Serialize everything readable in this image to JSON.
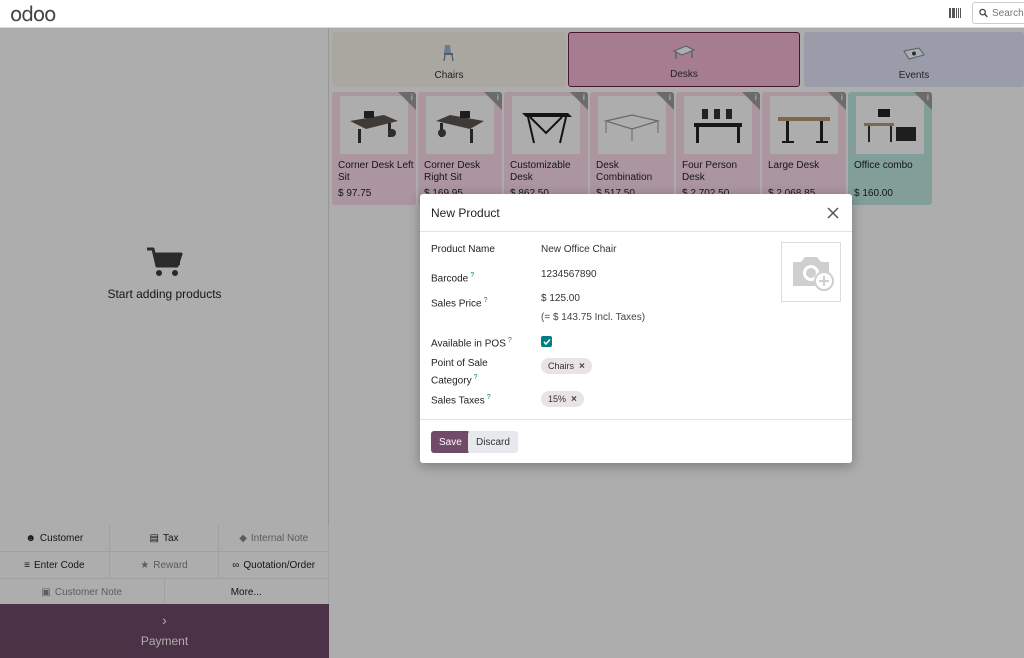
{
  "header": {
    "logo": "odoo",
    "search_placeholder": "Search..."
  },
  "cart": {
    "empty_message": "Start adding products"
  },
  "actions": {
    "customer": "Customer",
    "tax": "Tax",
    "internal_note": "Internal Note",
    "enter_code": "Enter Code",
    "reward": "Reward",
    "quotation_order": "Quotation/Order",
    "customer_note": "Customer Note",
    "more": "More..."
  },
  "payment": {
    "label": "Payment"
  },
  "categories": [
    {
      "label": "Chairs",
      "color": "#fbf5ec"
    },
    {
      "label": "Desks",
      "color": "#f5b7d4"
    },
    {
      "label": "Events",
      "color": "#e4e6fa"
    }
  ],
  "products": [
    {
      "name": "Corner Desk Left Sit",
      "price": "$ 97.75"
    },
    {
      "name": "Corner Desk Right Sit",
      "price": "$ 169.95"
    },
    {
      "name": "Customizable Desk",
      "price": "$ 862.50"
    },
    {
      "name": "Desk Combination",
      "price": "$ 517.50"
    },
    {
      "name": "Four Person Desk",
      "price": "$ 2,702.50"
    },
    {
      "name": "Large Desk",
      "price": "$ 2,068.85"
    },
    {
      "name": "Office combo",
      "price": "$ 160.00"
    }
  ],
  "modal": {
    "title": "New Product",
    "product_name_label": "Product Name",
    "product_name_value": "New Office Chair",
    "barcode_label": "Barcode",
    "barcode_value": "1234567890",
    "sales_price_label": "Sales Price",
    "sales_price_value": "$ 125.00",
    "sales_price_incl": "(= $ 143.75 Incl. Taxes)",
    "available_label": "Available in POS",
    "available_checked": true,
    "pos_category_label_1": "Point of Sale",
    "pos_category_label_2": "Category",
    "pos_category_tag": "Chairs",
    "sales_taxes_label": "Sales Taxes",
    "sales_taxes_tag": "15%",
    "help_mark": "?",
    "save_label": "Save",
    "discard_label": "Discard"
  },
  "colors": {
    "brand": "#714b67",
    "teal": "#017e84"
  }
}
